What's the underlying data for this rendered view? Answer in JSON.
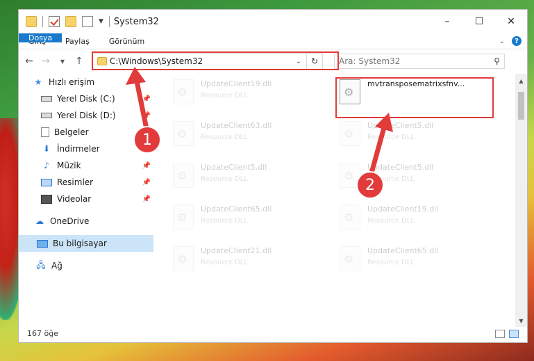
{
  "window": {
    "title": "System32",
    "controls": [
      "–",
      "☐",
      "✕"
    ]
  },
  "ribbon": {
    "tabs": [
      "Dosya",
      "Giriş",
      "Paylaş",
      "Görünüm"
    ]
  },
  "address": {
    "path": "C:\\Windows\\System32",
    "search_placeholder": "Ara: System32"
  },
  "sidebar": {
    "items": [
      {
        "label": "Hızlı erişim",
        "icon": "star-icon",
        "pinned": false
      },
      {
        "label": "Yerel Disk (C:)",
        "icon": "drive-icon",
        "pinned": true
      },
      {
        "label": "Yerel Disk (D:)",
        "icon": "drive-icon",
        "pinned": true
      },
      {
        "label": "Belgeler",
        "icon": "document-icon",
        "pinned": true
      },
      {
        "label": "İndirmeler",
        "icon": "download-icon",
        "pinned": true
      },
      {
        "label": "Müzik",
        "icon": "music-icon",
        "pinned": true
      },
      {
        "label": "Resimler",
        "icon": "picture-icon",
        "pinned": true
      },
      {
        "label": "Videolar",
        "icon": "video-icon",
        "pinned": true
      },
      {
        "label": "OneDrive",
        "icon": "cloud-icon",
        "pinned": false
      },
      {
        "label": "Bu bilgisayar",
        "icon": "computer-icon",
        "pinned": false
      },
      {
        "label": "Ağ",
        "icon": "network-icon",
        "pinned": false
      }
    ]
  },
  "files": [
    {
      "name": "UpdateClient19.dll",
      "desc": "Resource DLL"
    },
    {
      "name": "mvtransposematrixsfnv...",
      "desc": ""
    },
    {
      "name": "UpdateClient63.dll",
      "desc": "Resource DLL"
    },
    {
      "name": "UpdateClient5.dll",
      "desc": "Resource DLL"
    },
    {
      "name": "UpdateClient5.dll",
      "desc": "Resource DLL"
    },
    {
      "name": "UpdateClient5.dll",
      "desc": "Resource DLL"
    },
    {
      "name": "UpdateClient65.dll",
      "desc": "Resource DLL"
    },
    {
      "name": "UpdateClient19.dll",
      "desc": "Resource DLL"
    },
    {
      "name": "UpdateClient21.dll",
      "desc": "Resource DLL"
    },
    {
      "name": "UpdateClient65.dll",
      "desc": "Resource DLL"
    }
  ],
  "status": {
    "count": "167 öğe"
  },
  "annotations": {
    "step1": "1",
    "step2": "2",
    "color": "#e23b3b"
  }
}
